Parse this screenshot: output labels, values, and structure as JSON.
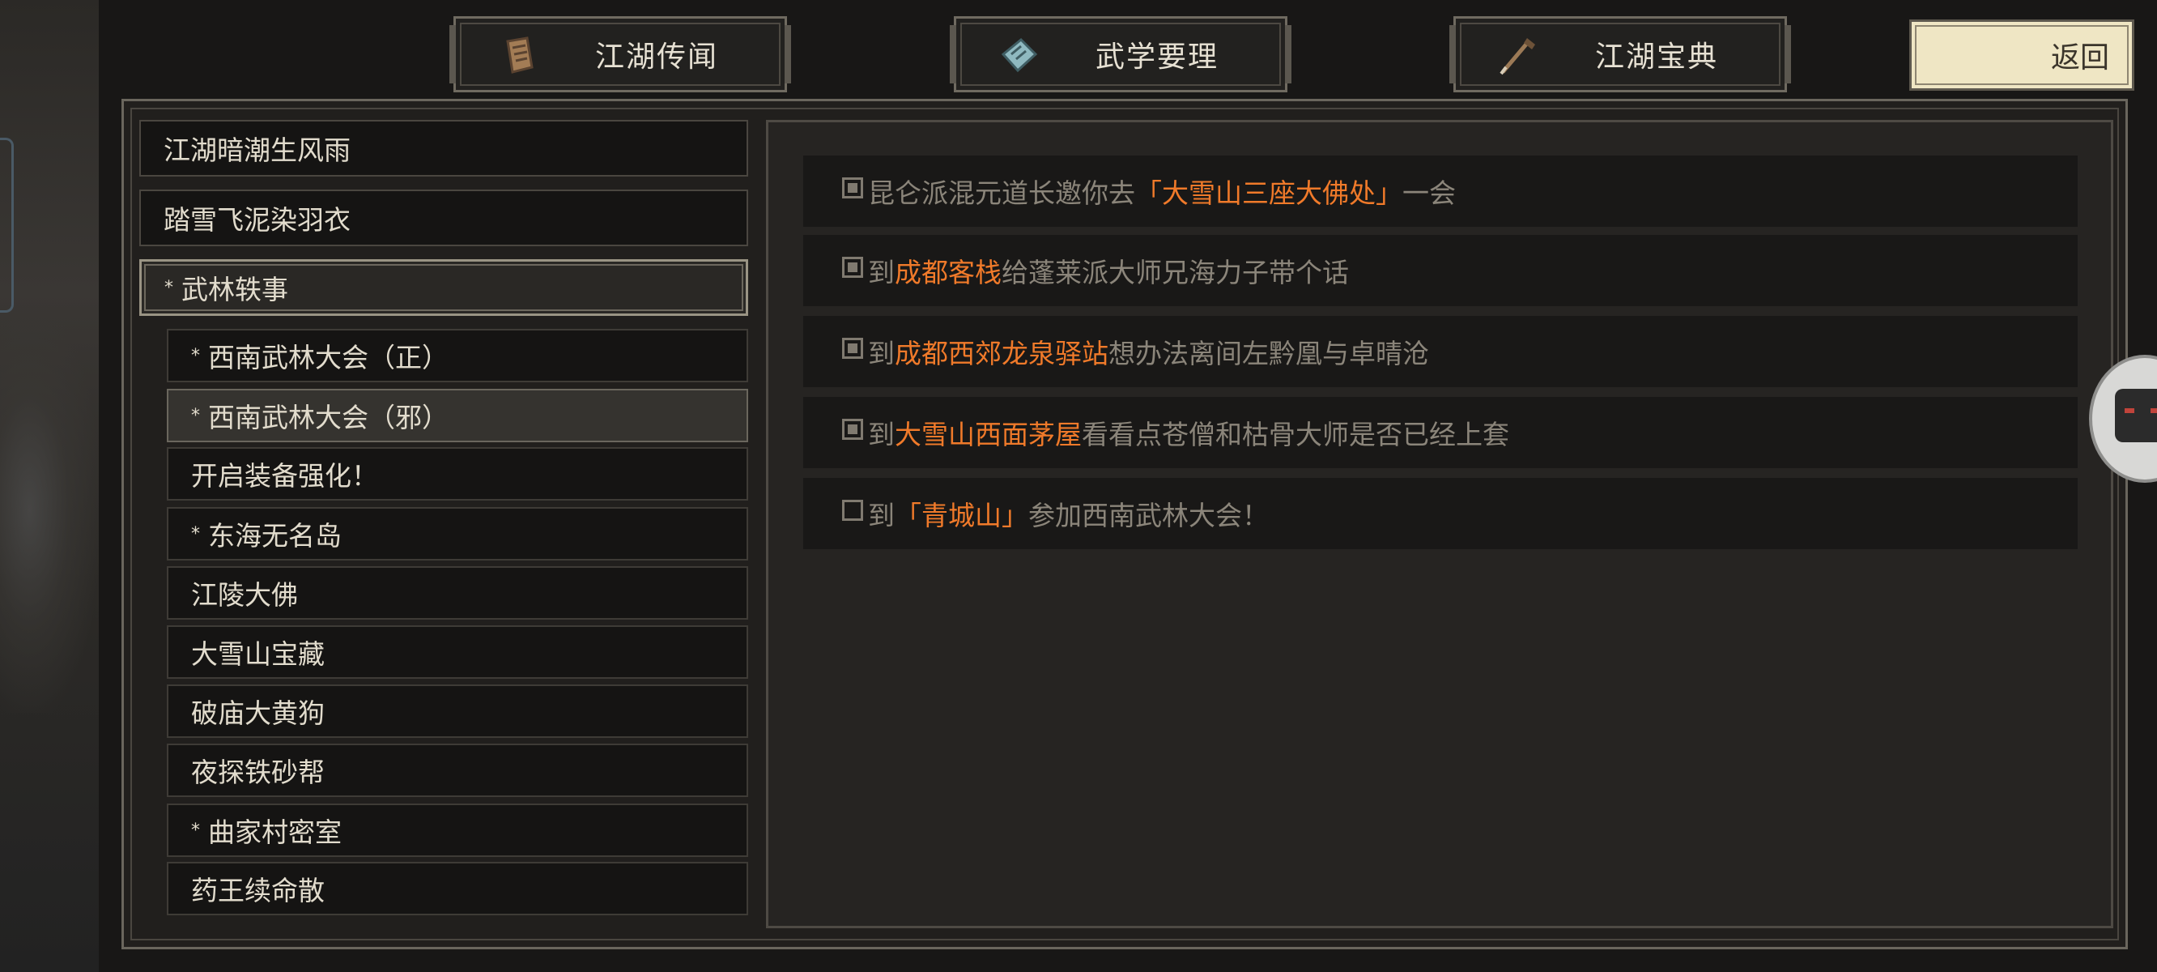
{
  "tabs": [
    {
      "label": "江湖传闻",
      "icon": "scroll-icon"
    },
    {
      "label": "武学要理",
      "icon": "manual-icon"
    },
    {
      "label": "江湖宝典",
      "icon": "brush-icon"
    }
  ],
  "back_label": "返回",
  "quest_list": [
    {
      "label": "江湖暗潮生风雨",
      "level": 0,
      "marked": false
    },
    {
      "label": "踏雪飞泥染羽衣",
      "level": 0,
      "marked": false
    },
    {
      "label": "武林轶事",
      "level": 0,
      "marked": true,
      "open": true
    },
    {
      "label": "西南武林大会（正）",
      "level": 1,
      "marked": true
    },
    {
      "label": "西南武林大会（邪）",
      "level": 1,
      "marked": true,
      "selected": true
    },
    {
      "label": "开启装备强化！",
      "level": 1,
      "marked": false
    },
    {
      "label": "东海无名岛",
      "level": 1,
      "marked": true
    },
    {
      "label": "江陵大佛",
      "level": 1,
      "marked": false
    },
    {
      "label": "大雪山宝藏",
      "level": 1,
      "marked": false
    },
    {
      "label": "破庙大黄狗",
      "level": 1,
      "marked": false
    },
    {
      "label": "夜探铁砂帮",
      "level": 1,
      "marked": false
    },
    {
      "label": "曲家村密室",
      "level": 1,
      "marked": true
    },
    {
      "label": "药王续命散",
      "level": 1,
      "marked": false
    }
  ],
  "tasks": [
    {
      "done": true,
      "segments": [
        {
          "t": "昆仑派混元道长邀你去"
        },
        {
          "t": "「大雪山三座大佛处」",
          "hl": true
        },
        {
          "t": "一会"
        }
      ]
    },
    {
      "done": true,
      "segments": [
        {
          "t": "到"
        },
        {
          "t": "成都客栈",
          "hl": true
        },
        {
          "t": "给蓬莱派大师兄海力子带个话"
        }
      ]
    },
    {
      "done": true,
      "segments": [
        {
          "t": "到"
        },
        {
          "t": "成都西郊龙泉驿站",
          "hl": true
        },
        {
          "t": "想办法离间左黔凰与卓晴沧"
        }
      ]
    },
    {
      "done": true,
      "segments": [
        {
          "t": "到"
        },
        {
          "t": "大雪山西面茅屋",
          "hl": true
        },
        {
          "t": "看看点苍僧和枯骨大师是否已经上套"
        }
      ]
    },
    {
      "done": false,
      "segments": [
        {
          "t": "到"
        },
        {
          "t": "「青城山」",
          "hl": true
        },
        {
          "t": "参加西南武林大会！"
        }
      ]
    }
  ],
  "colors": {
    "highlight": "#f07a2a",
    "dim_text": "#8b857a",
    "text": "#e2dccd"
  }
}
